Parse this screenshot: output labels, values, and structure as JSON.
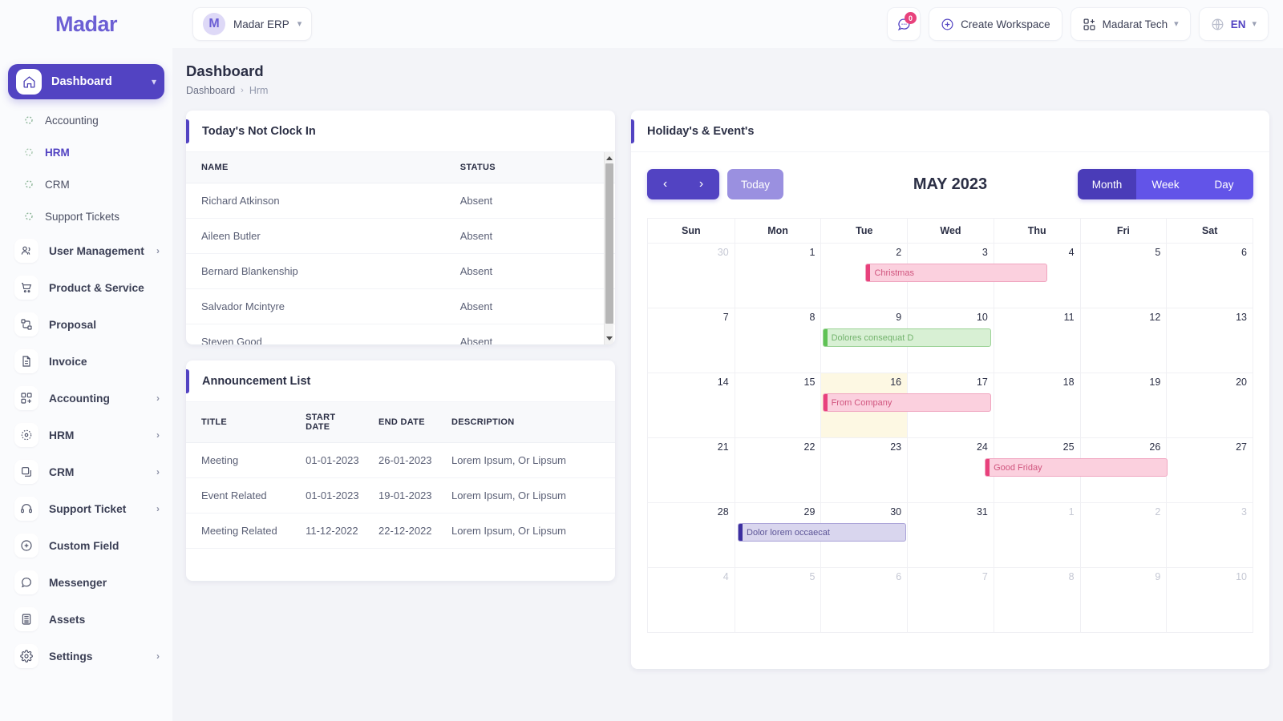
{
  "topbar": {
    "logo_text": "Madar",
    "workspace": {
      "initial": "M",
      "name": "Madar ERP"
    },
    "notifications": {
      "count": "0",
      "icon": "chat-bubble-icon"
    },
    "create_workspace_label": "Create Workspace",
    "company": {
      "name": "Madarat Tech",
      "icon": "grid-plus-icon"
    },
    "language": {
      "label": "EN",
      "icon": "globe-icon"
    }
  },
  "sidebar": {
    "active": {
      "label": "Dashboard",
      "icon": "home-icon"
    },
    "sub_items": [
      {
        "label": "Accounting",
        "selected": false
      },
      {
        "label": "HRM",
        "selected": true
      },
      {
        "label": "CRM",
        "selected": false
      },
      {
        "label": "Support Tickets",
        "selected": false
      }
    ],
    "items": [
      {
        "label": "User Management",
        "icon": "users-icon",
        "arrow": "›"
      },
      {
        "label": "Product & Service",
        "icon": "cart-icon",
        "arrow": ""
      },
      {
        "label": "Proposal",
        "icon": "shuffle-squares-icon",
        "arrow": ""
      },
      {
        "label": "Invoice",
        "icon": "document-icon",
        "arrow": ""
      },
      {
        "label": "Accounting",
        "icon": "grid-plus-icon",
        "arrow": "›"
      },
      {
        "label": "HRM",
        "icon": "dotted-circle-icon",
        "arrow": "›"
      },
      {
        "label": "CRM",
        "icon": "overlap-squares-icon",
        "arrow": "›"
      },
      {
        "label": "Support Ticket",
        "icon": "headset-icon",
        "arrow": "›"
      },
      {
        "label": "Custom Field",
        "icon": "plus-circle-icon",
        "arrow": ""
      },
      {
        "label": "Messenger",
        "icon": "chat-bubble-icon",
        "arrow": ""
      },
      {
        "label": "Assets",
        "icon": "calculator-icon",
        "arrow": ""
      },
      {
        "label": "Settings",
        "icon": "gear-icon",
        "arrow": "›"
      }
    ]
  },
  "page": {
    "title": "Dashboard",
    "breadcrumb": {
      "root": "Dashboard",
      "sep": "›",
      "current": "Hrm"
    }
  },
  "clock_in_card": {
    "title": "Today's Not Clock In",
    "columns": [
      "NAME",
      "STATUS"
    ],
    "rows": [
      {
        "name": "Richard Atkinson",
        "status": "Absent"
      },
      {
        "name": "Aileen Butler",
        "status": "Absent"
      },
      {
        "name": "Bernard Blankenship",
        "status": "Absent"
      },
      {
        "name": "Salvador Mcintyre",
        "status": "Absent"
      },
      {
        "name": "Steven Good",
        "status": "Absent"
      }
    ]
  },
  "announcement_card": {
    "title": "Announcement List",
    "columns": [
      "TITLE",
      "START DATE",
      "END DATE",
      "DESCRIPTION"
    ],
    "rows": [
      {
        "title": "Meeting",
        "start": "01-01-2023",
        "end": "26-01-2023",
        "desc": "Lorem Ipsum, Or Lipsum"
      },
      {
        "title": "Event Related",
        "start": "01-01-2023",
        "end": "19-01-2023",
        "desc": "Lorem Ipsum, Or Lipsum"
      },
      {
        "title": "Meeting Related",
        "start": "11-12-2022",
        "end": "22-12-2022",
        "desc": "Lorem Ipsum, Or Lipsum"
      }
    ]
  },
  "calendar_card": {
    "title": "Holiday's & Event's",
    "toolbar": {
      "prev": "‹",
      "next": "›",
      "today_label": "Today",
      "period_title": "MAY 2023",
      "views": [
        {
          "label": "Month",
          "active": true
        },
        {
          "label": "Week",
          "active": false
        },
        {
          "label": "Day",
          "active": false
        }
      ]
    },
    "day_names": [
      "Sun",
      "Mon",
      "Tue",
      "Wed",
      "Thu",
      "Fri",
      "Sat"
    ],
    "weeks": [
      [
        {
          "num": "30",
          "other": true
        },
        {
          "num": "1"
        },
        {
          "num": "2"
        },
        {
          "num": "3"
        },
        {
          "num": "4"
        },
        {
          "num": "5"
        },
        {
          "num": "6"
        }
      ],
      [
        {
          "num": "7"
        },
        {
          "num": "8"
        },
        {
          "num": "9"
        },
        {
          "num": "10"
        },
        {
          "num": "11"
        },
        {
          "num": "12"
        },
        {
          "num": "13"
        }
      ],
      [
        {
          "num": "14"
        },
        {
          "num": "15"
        },
        {
          "num": "16",
          "today": true
        },
        {
          "num": "17"
        },
        {
          "num": "18"
        },
        {
          "num": "19"
        },
        {
          "num": "20"
        }
      ],
      [
        {
          "num": "21"
        },
        {
          "num": "22"
        },
        {
          "num": "23"
        },
        {
          "num": "24"
        },
        {
          "num": "25"
        },
        {
          "num": "26"
        },
        {
          "num": "27"
        }
      ],
      [
        {
          "num": "28"
        },
        {
          "num": "29"
        },
        {
          "num": "30"
        },
        {
          "num": "31"
        },
        {
          "num": "1",
          "other": true
        },
        {
          "num": "2",
          "other": true
        },
        {
          "num": "3",
          "other": true
        }
      ],
      [
        {
          "num": "4",
          "other": true
        },
        {
          "num": "5",
          "other": true
        },
        {
          "num": "6",
          "other": true
        },
        {
          "num": "7",
          "other": true
        },
        {
          "num": "8",
          "other": true
        },
        {
          "num": "9",
          "other": true
        },
        {
          "num": "10",
          "other": true
        }
      ]
    ],
    "events": [
      {
        "label": "Christmas",
        "week": 0,
        "start_col": 2.52,
        "span": 2.1,
        "color": "pink"
      },
      {
        "label": "Dolores consequat D",
        "week": 1,
        "start_col": 2.02,
        "span": 1.95,
        "color": "green"
      },
      {
        "label": "From Company",
        "week": 2,
        "start_col": 2.02,
        "span": 1.95,
        "color": "pink"
      },
      {
        "label": "Good Friday",
        "week": 3,
        "start_col": 3.9,
        "span": 2.12,
        "color": "pink"
      },
      {
        "label": "Dolor lorem occaecat",
        "week": 4,
        "start_col": 1.04,
        "span": 1.95,
        "color": "purple"
      }
    ]
  },
  "colors": {
    "accent": "#5243c2",
    "accent_light": "#9a90e0",
    "view_button": "#6254e8",
    "badge": "#e8427c",
    "event_pink": "#fbd0de",
    "event_green": "#d8f0d4",
    "event_purple": "#d9d6ee",
    "today_bg": "#fdf8e3",
    "page_bg": "#f3f4f8"
  }
}
